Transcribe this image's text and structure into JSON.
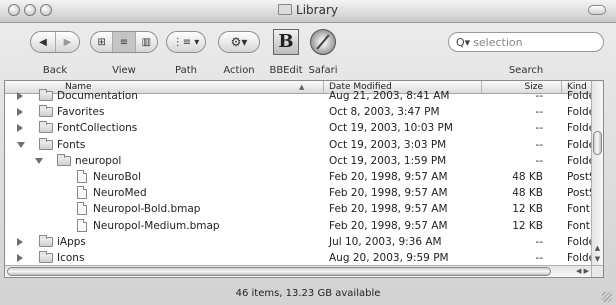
{
  "window": {
    "title": "Library"
  },
  "toolbar": {
    "back_label": "Back",
    "view_label": "View",
    "path_label": "Path",
    "action_label": "Action",
    "bbedit_label": "BBEdit",
    "safari_label": "Safari",
    "search_label": "Search",
    "search_placeholder": "selection",
    "back_icon": "back-forward-arrows-icon",
    "view_icons": [
      "icon-view-icon",
      "list-view-icon",
      "column-view-icon"
    ],
    "path_icon": "path-menu-icon",
    "action_icon": "gear-icon"
  },
  "columns": {
    "name": "Name",
    "date": "Date Modified",
    "size": "Size",
    "kind": "Kind"
  },
  "rows": [
    {
      "name": "Documentation",
      "date": "Aug 21, 2003, 8:41 AM",
      "size": "--",
      "kind": "Folder",
      "type": "folder",
      "expanded": false,
      "depth": 0
    },
    {
      "name": "Favorites",
      "date": "Oct 8, 2003, 3:47 PM",
      "size": "--",
      "kind": "Folder",
      "type": "folder",
      "expanded": false,
      "depth": 0
    },
    {
      "name": "FontCollections",
      "date": "Oct 19, 2003, 10:03 PM",
      "size": "--",
      "kind": "Folder",
      "type": "folder",
      "expanded": false,
      "depth": 0
    },
    {
      "name": "Fonts",
      "date": "Oct 19, 2003, 3:03 PM",
      "size": "--",
      "kind": "Folder",
      "type": "folder",
      "expanded": true,
      "depth": 0
    },
    {
      "name": "neuropol",
      "date": "Oct 19, 2003, 1:59 PM",
      "size": "--",
      "kind": "Folder",
      "type": "folder",
      "expanded": true,
      "depth": 1
    },
    {
      "name": "NeuroBol",
      "date": "Feb 20, 1998, 9:57 AM",
      "size": "48 KB",
      "kind": "PostS",
      "type": "file",
      "depth": 2
    },
    {
      "name": "NeuroMed",
      "date": "Feb 20, 1998, 9:57 AM",
      "size": "48 KB",
      "kind": "PostS",
      "type": "file",
      "depth": 2
    },
    {
      "name": "Neuropol-Bold.bmap",
      "date": "Feb 20, 1998, 9:57 AM",
      "size": "12 KB",
      "kind": "Font Su",
      "type": "file",
      "depth": 2
    },
    {
      "name": "Neuropol-Medium.bmap",
      "date": "Feb 20, 1998, 9:57 AM",
      "size": "12 KB",
      "kind": "Font Su",
      "type": "file",
      "depth": 2
    },
    {
      "name": "iApps",
      "date": "Jul 10, 2003, 9:36 AM",
      "size": "--",
      "kind": "Folder",
      "type": "folder",
      "expanded": false,
      "depth": 0
    },
    {
      "name": "Icons",
      "date": "Aug 20, 2003, 9:59 PM",
      "size": "--",
      "kind": "Folder",
      "type": "folder",
      "expanded": false,
      "depth": 0
    }
  ],
  "status": {
    "text": "46 items, 13.23 GB available"
  }
}
